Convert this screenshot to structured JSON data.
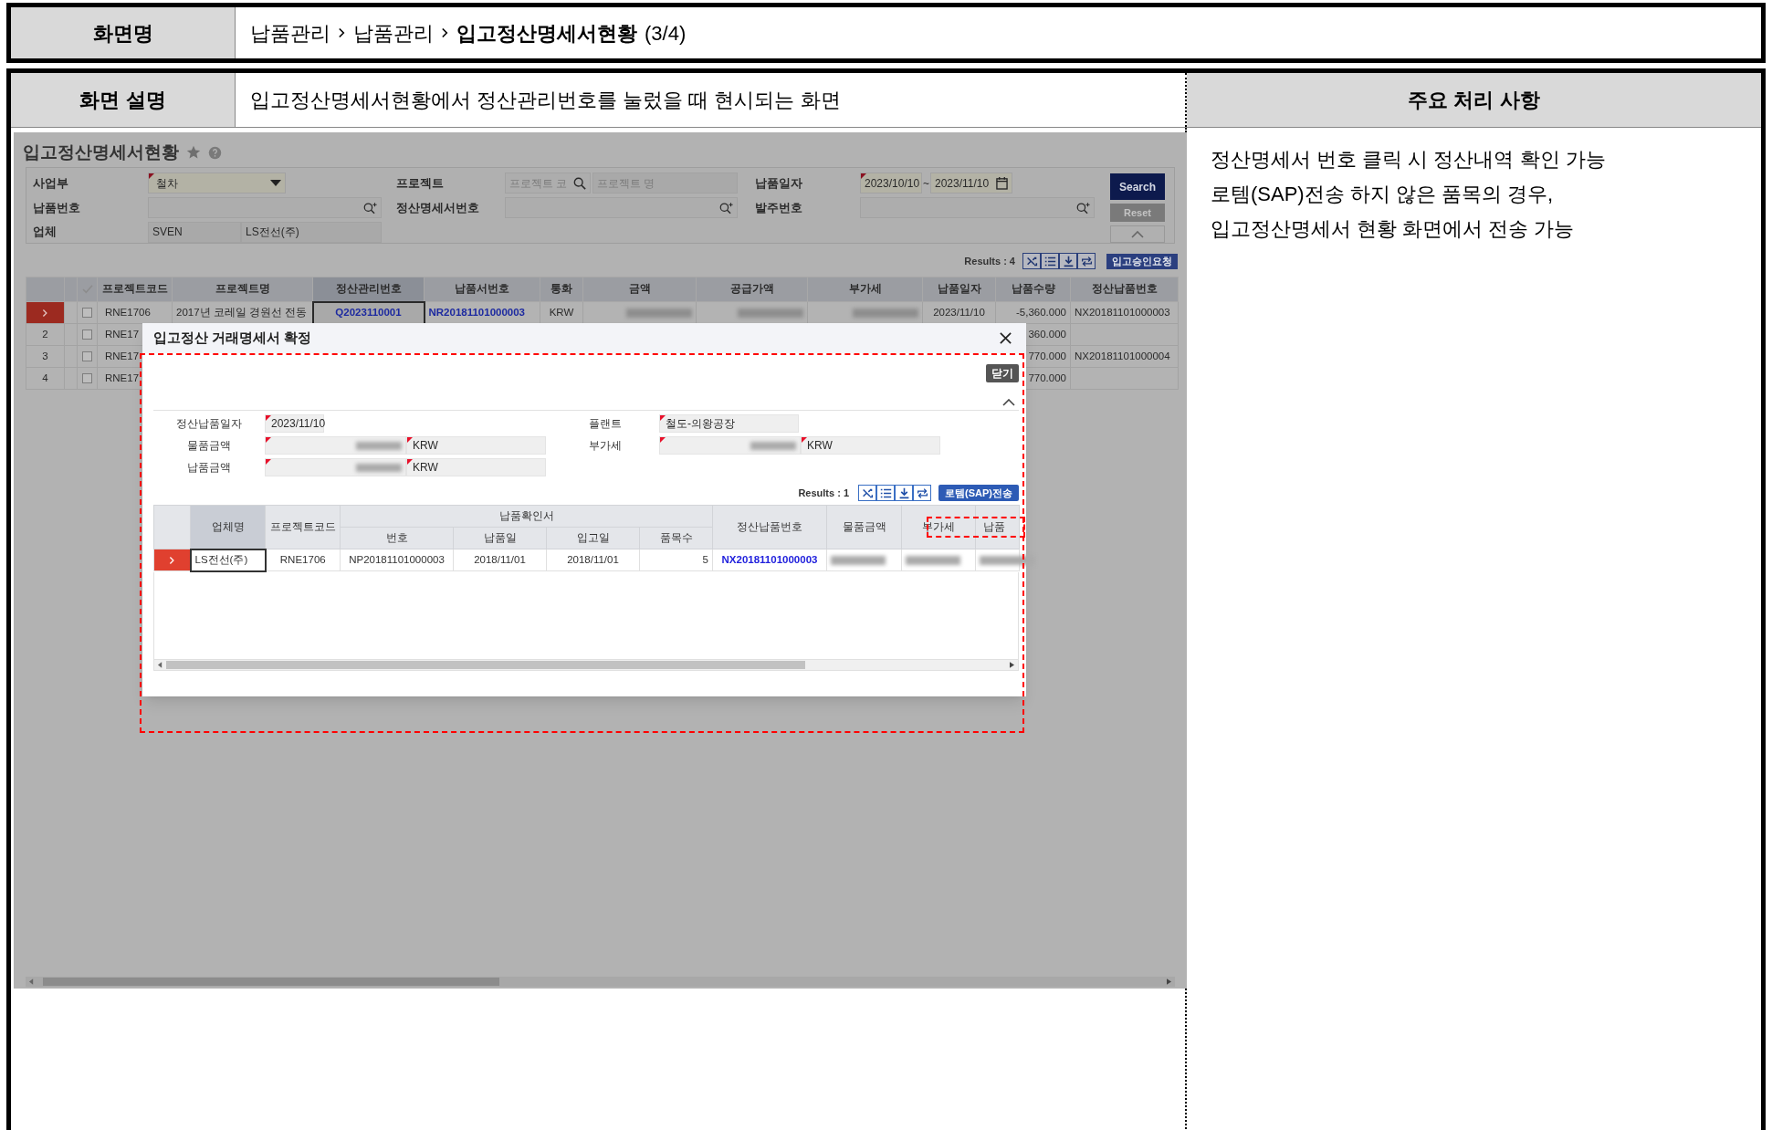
{
  "screen_name": {
    "label": "화면명",
    "breadcrumb": [
      {
        "text": "납품관리",
        "current": false
      },
      {
        "text": "납품관리",
        "current": false
      },
      {
        "text": "입고정산명세서현황",
        "current": true
      }
    ],
    "page_count": "(3/4)"
  },
  "description": {
    "label": "화면 설명",
    "text": "입고정산명세서현황에서 정산관리번호를 눌렀을 때 현시되는 화면"
  },
  "notes": {
    "title": "주요 처리 사항",
    "lines": [
      "정산명세서 번호 클릭 시 정산내역 확인 가능",
      "로템(SAP)전송 하지 않은 품목의 경우,",
      "입고정산명세서 현황 화면에서 전송 가능"
    ]
  },
  "screenshot": {
    "title": "입고정산명세서현황",
    "search": {
      "business_unit": {
        "label": "사업부",
        "value": "철차",
        "required": true
      },
      "project": {
        "label": "프로젝트",
        "code_placeholder": "프로젝트 코",
        "name_placeholder": "프로젝트 명"
      },
      "delivery_date": {
        "label": "납품일자",
        "from": "2023/10/10",
        "separator": "~",
        "to": "2023/11/10",
        "required": true
      },
      "delivery_no": {
        "label": "납품번호"
      },
      "statement_no": {
        "label": "정산명세서번호"
      },
      "order_no": {
        "label": "발주번호"
      },
      "vendor": {
        "label": "업체",
        "code": "SVEN",
        "name": "LS전선(주)"
      },
      "search_button": "Search",
      "reset_button": "Reset"
    },
    "results": "Results : 4",
    "approve_button": "입고승인요청",
    "table": {
      "columns": [
        {
          "label": "프로젝트코드",
          "kind": "text",
          "selected": false
        },
        {
          "label": "프로젝트명",
          "kind": "text",
          "selected": false
        },
        {
          "label": "정산관리번호",
          "kind": "link",
          "selected": true
        },
        {
          "label": "납품서번호",
          "kind": "link",
          "selected": false
        },
        {
          "label": "통화",
          "kind": "text",
          "selected": false
        },
        {
          "label": "금액",
          "kind": "text",
          "selected": false
        },
        {
          "label": "공급가액",
          "kind": "text",
          "selected": false
        },
        {
          "label": "부가세",
          "kind": "text",
          "selected": false
        },
        {
          "label": "납품일자",
          "kind": "text",
          "selected": false
        },
        {
          "label": "납품수량",
          "kind": "text",
          "selected": false
        },
        {
          "label": "정산납품번호",
          "kind": "text",
          "selected": false
        }
      ],
      "rows": [
        {
          "selected": true,
          "checked": false,
          "cells": [
            "RNE1706",
            "2017년 코레일 경원선 전동",
            "Q2023110001",
            "NR20181101000003",
            "KRW",
            {
              "kind": "masked"
            },
            {
              "kind": "masked"
            },
            {
              "kind": "masked"
            },
            "2023/11/10",
            "-5,360.000",
            "NX20181101000003"
          ]
        },
        {
          "selected": false,
          "number": "2",
          "checked": false,
          "cells": [
            "RNE17",
            null,
            null,
            null,
            null,
            null,
            null,
            null,
            null,
            "360.000",
            null
          ]
        },
        {
          "selected": false,
          "number": "3",
          "checked": false,
          "cells": [
            "RNE17",
            null,
            null,
            null,
            null,
            null,
            null,
            null,
            null,
            "770.000",
            "NX20181101000004"
          ]
        },
        {
          "selected": false,
          "number": "4",
          "checked": false,
          "cells": [
            "RNE17",
            null,
            null,
            null,
            null,
            null,
            null,
            null,
            null,
            "770.000",
            null
          ]
        }
      ]
    },
    "modal": {
      "title": "입고정산 거래명세서 확정",
      "close_button": "닫기",
      "form": {
        "settle_date": {
          "label": "정산납품일자",
          "value": "2023/11/10",
          "required": true
        },
        "plant": {
          "label": "플랜트",
          "value": "철도-의왕공장",
          "required": true
        },
        "goods_amount": {
          "label": "물품금액",
          "currency": "KRW",
          "required": true
        },
        "vat": {
          "label": "부가세",
          "currency": "KRW",
          "required": true
        },
        "delivery_amount": {
          "label": "납품금액",
          "currency": "KRW",
          "required": true
        }
      },
      "results": "Results : 1",
      "send_button": "로템(SAP)전송",
      "grid": {
        "group_label": "납품확인서",
        "columns": [
          {
            "label": "업체명",
            "grouped": false,
            "selected": true,
            "kind": "text"
          },
          {
            "label": "프로젝트코드",
            "grouped": false,
            "selected": false,
            "kind": "text"
          },
          {
            "label": "번호",
            "grouped": true,
            "selected": false,
            "kind": "text"
          },
          {
            "label": "납품일",
            "grouped": true,
            "selected": false,
            "kind": "text"
          },
          {
            "label": "입고일",
            "grouped": true,
            "selected": false,
            "kind": "text"
          },
          {
            "label": "품목수",
            "grouped": true,
            "selected": false,
            "kind": "text"
          },
          {
            "label": "정산납품번호",
            "grouped": false,
            "selected": false,
            "kind": "link"
          },
          {
            "label": "물품금액",
            "grouped": false,
            "selected": false,
            "kind": "text"
          },
          {
            "label": "부가세",
            "grouped": false,
            "selected": false,
            "kind": "text"
          },
          {
            "label": "납품",
            "grouped": false,
            "selected": false,
            "kind": "text"
          }
        ],
        "rows": [
          {
            "selected": true,
            "cells": [
              "LS전선(주)",
              "RNE1706",
              "NP20181101000003",
              "2018/11/01",
              "2018/11/01",
              "5",
              "NX20181101000003",
              {
                "kind": "masked"
              },
              {
                "kind": "masked"
              },
              {
                "kind": "masked"
              }
            ]
          }
        ]
      }
    }
  }
}
